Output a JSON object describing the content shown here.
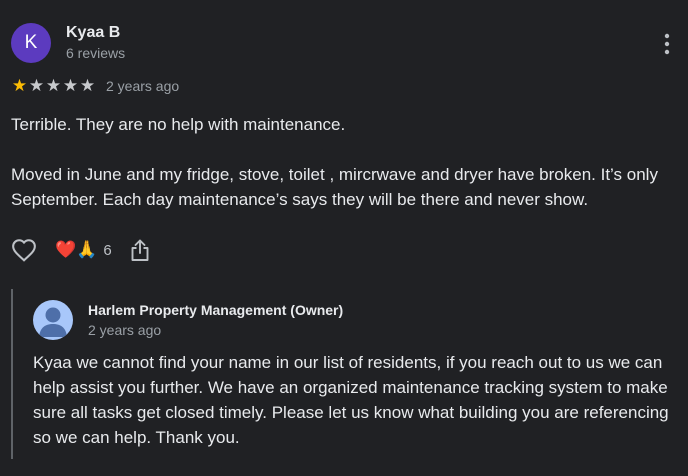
{
  "review": {
    "author_initial": "K",
    "author_name": "Kyaa B",
    "author_reviews": "6 reviews",
    "rating": 1,
    "max_rating": 5,
    "time_ago": "2 years ago",
    "text_paragraphs": [
      "Terrible. They are no help with maintenance.",
      "Moved in June and my fridge, stove, toilet , mircrwave and dryer have broken. It’s only September. Each day maintenance’s says they will be there and never show."
    ],
    "reactions": {
      "emojis": "❤️🙏",
      "count": "6"
    }
  },
  "owner_reply": {
    "name": "Harlem Property Management (Owner)",
    "time_ago": "2 years ago",
    "text": "Kyaa we cannot find your name in our list of residents, if you reach out to us we can help assist you further. We have an organized maintenance tracking system to make sure all tasks get closed timely. Please let us know what building you are referencing so we can help. Thank you."
  },
  "icons": {
    "more": "more-vert-icon",
    "like": "heart-outline-icon",
    "share": "share-icon",
    "owner_avatar": "person-icon"
  },
  "colors": {
    "background": "#202124",
    "avatar": "#5c3bbf",
    "star_filled": "#fbbc04",
    "star_empty": "#c7c9cc",
    "owner_avatar": "#a8c7fa"
  }
}
